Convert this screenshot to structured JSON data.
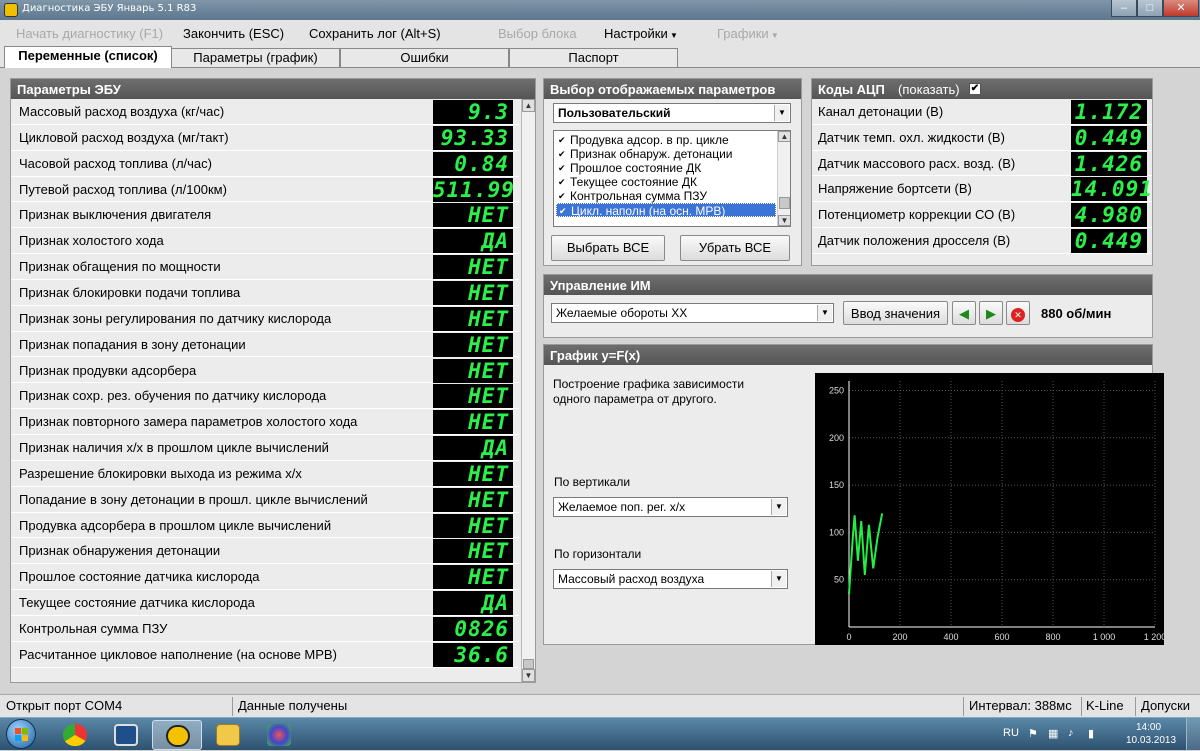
{
  "window": {
    "title": "Диагностика ЭБУ Январь 5.1 R83"
  },
  "menu": [
    {
      "label": "Начать диагностику (F1)",
      "enabled": false
    },
    {
      "label": "Закончить (ESC)",
      "enabled": true
    },
    {
      "label": "Сохранить лог (Alt+S)",
      "enabled": true
    },
    {
      "label": "Выбор блока",
      "enabled": false
    },
    {
      "label": "Настройки",
      "enabled": true
    },
    {
      "label": "Графики",
      "enabled": false
    }
  ],
  "tabs": [
    "Переменные (список)",
    "Параметры (график)",
    "Ошибки",
    "Паспорт"
  ],
  "ecu": {
    "title": "Параметры ЭБУ",
    "rows": [
      {
        "label": "Массовый расход воздуха (кг/час)",
        "value": "9.3"
      },
      {
        "label": "Цикловой расход воздуха (мг/такт)",
        "value": "93.33"
      },
      {
        "label": "Часовой расход топлива (л/час)",
        "value": "0.84"
      },
      {
        "label": "Путевой расход топлива (л/100км)",
        "value": "511.99"
      },
      {
        "label": "Признак выключения двигателя",
        "value": "НЕТ"
      },
      {
        "label": "Признак холостого хода",
        "value": "ДА"
      },
      {
        "label": "Признак обгащения по мощности",
        "value": "НЕТ"
      },
      {
        "label": "Признак блокировки подачи топлива",
        "value": "НЕТ"
      },
      {
        "label": "Признак зоны регулирования по датчику кислорода",
        "value": "НЕТ"
      },
      {
        "label": "Признак попадания в зону детонации",
        "value": "НЕТ"
      },
      {
        "label": "Признак продувки адсорбера",
        "value": "НЕТ"
      },
      {
        "label": "Признак сохр. рез. обучения по датчику кислорода",
        "value": "НЕТ"
      },
      {
        "label": "Признак повторного замера параметров холостого хода",
        "value": "НЕТ"
      },
      {
        "label": "Признак наличия х/х в прошлом цикле вычислений",
        "value": "ДА"
      },
      {
        "label": "Разрешение блокировки выхода из режима х/х",
        "value": "НЕТ"
      },
      {
        "label": "Попадание в зону детонации в прошл. цикле вычислений",
        "value": "НЕТ"
      },
      {
        "label": "Продувка адсорбера в прошлом цикле вычислений",
        "value": "НЕТ"
      },
      {
        "label": "Признак обнаружения детонации",
        "value": "НЕТ"
      },
      {
        "label": "Прошлое состояние датчика кислорода",
        "value": "НЕТ"
      },
      {
        "label": "Текущее состояние датчика кислорода",
        "value": "ДА"
      },
      {
        "label": "Контрольная сумма ПЗУ",
        "value": "0826"
      },
      {
        "label": "Расчитанное цикловое наполнение (на основе МРВ)",
        "value": "36.6"
      }
    ]
  },
  "select_params": {
    "title": "Выбор отображаемых параметров",
    "preset": "Пользовательский",
    "items": [
      {
        "label": "Продувка адсор. в пр. цикле",
        "checked": true,
        "selected": false
      },
      {
        "label": "Признак обнаруж. детонации",
        "checked": true,
        "selected": false
      },
      {
        "label": "Прошлое состояние ДК",
        "checked": true,
        "selected": false
      },
      {
        "label": "Текущее состояние ДК",
        "checked": true,
        "selected": false
      },
      {
        "label": "Контрольная сумма ПЗУ",
        "checked": true,
        "selected": false
      },
      {
        "label": "Цикл. наполн (на осн. МРВ)",
        "checked": true,
        "selected": true
      }
    ],
    "select_all": "Выбрать ВСЕ",
    "clear_all": "Убрать ВСЕ"
  },
  "adc": {
    "title": "Коды АЦП",
    "show_label": "(показать)",
    "show_checked": true,
    "rows": [
      {
        "label": "Канал детонации (В)",
        "value": "1.172"
      },
      {
        "label": "Датчик темп. охл. жидкости (В)",
        "value": "0.449"
      },
      {
        "label": "Датчик массового расх. возд. (В)",
        "value": "1.426"
      },
      {
        "label": "Напряжение бортсети (В)",
        "value": "14.091"
      },
      {
        "label": "Потенциометр коррекции СО (В)",
        "value": "4.980"
      },
      {
        "label": "Датчик положения дросселя (В)",
        "value": "0.449"
      }
    ]
  },
  "control": {
    "title": "Управление ИМ",
    "param": "Желаемые обороты ХХ",
    "enter_label": "Ввод значения",
    "value": "880 об/мин"
  },
  "graph": {
    "title": "График y=F(x)",
    "description": "Построение графика зависимости одного параметра от другого.",
    "vertical_label": "По вертикали",
    "vertical_value": "Желаемое поп. рег. х/х",
    "horizontal_label": "По горизонтали",
    "horizontal_value": "Массовый расход воздуха"
  },
  "chart_data": {
    "type": "line",
    "title": "",
    "xlabel": "",
    "ylabel": "",
    "xlim": [
      0,
      1200
    ],
    "ylim": [
      0,
      260
    ],
    "x_ticks": [
      "0",
      "200",
      "400",
      "600",
      "800",
      "1 000",
      "1 200"
    ],
    "y_ticks": [
      "50",
      "100",
      "150",
      "200",
      "250"
    ],
    "grid": true,
    "line_color": "#22ee44",
    "x": [
      0,
      15,
      22,
      35,
      48,
      62,
      78,
      95,
      112,
      130
    ],
    "y": [
      35,
      95,
      118,
      70,
      112,
      55,
      108,
      62,
      95,
      120
    ]
  },
  "status": {
    "port": "Открыт порт COM4",
    "data": "Данные получены",
    "interval": "Интервал: 388мс",
    "protocol": "K-Line",
    "tolerance": "Допуски"
  },
  "taskbar": {
    "lang": "RU",
    "time": "14:00",
    "date": "10.03.2013"
  }
}
